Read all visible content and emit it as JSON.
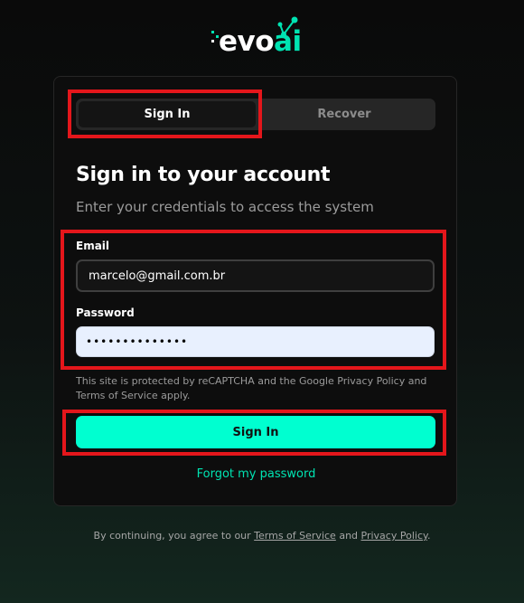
{
  "brand": {
    "logo_text_white": "evo",
    "logo_text_green": "ai",
    "accent": "#00e3b2",
    "button_color": "#00ffd0"
  },
  "tabs": [
    {
      "label": "Sign In",
      "active": true
    },
    {
      "label": "Recover",
      "active": false
    }
  ],
  "form": {
    "title": "Sign in to your account",
    "subtitle": "Enter your credentials to access the system",
    "email_label": "Email",
    "email_value": "marcelo@gmail.com.br",
    "password_label": "Password",
    "password_value": "••••••••••••••",
    "recaptcha_text": "This site is protected by reCAPTCHA and the Google Privacy Policy and Terms of Service apply.",
    "submit_label": "Sign In",
    "forgot_label": "Forgot my password"
  },
  "footer": {
    "prefix": "By continuing, you agree to our ",
    "terms": "Terms of Service",
    "and": " and ",
    "privacy": "Privacy Policy",
    "suffix": "."
  },
  "highlight_color": "#e4161b"
}
